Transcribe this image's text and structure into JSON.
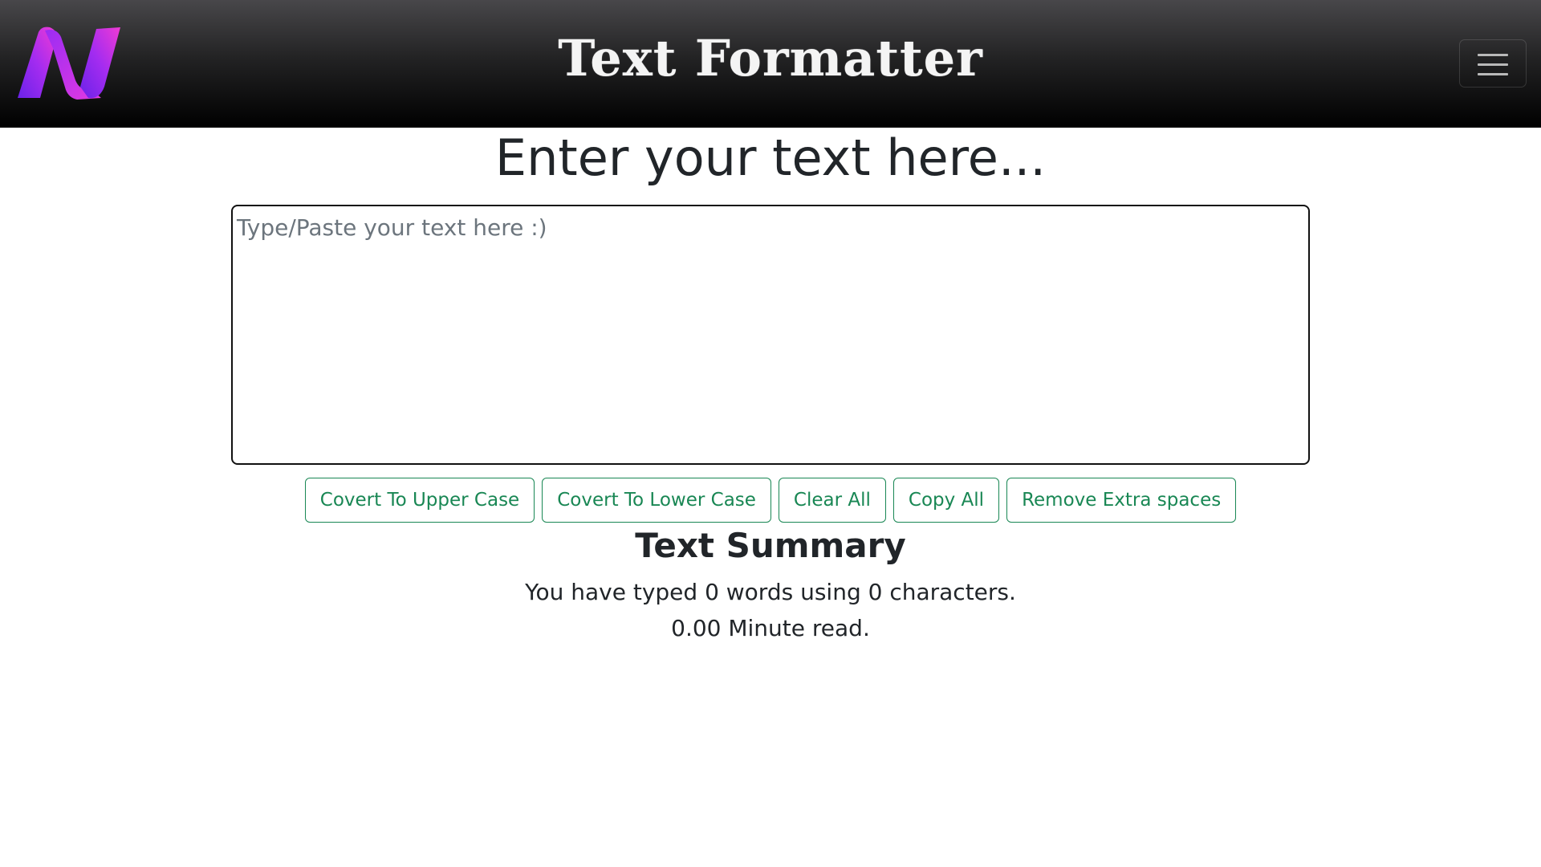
{
  "navbar": {
    "title": "Text Formatter",
    "logo_icon": "n-logo-icon",
    "menu_icon": "hamburger-menu-icon",
    "colors": {
      "logo_gradient_start": "#7b2ff7",
      "logo_gradient_end": "#f23ad6"
    }
  },
  "main": {
    "heading": "Enter your text here...",
    "textarea": {
      "placeholder": "Type/Paste your text here :)",
      "value": ""
    },
    "buttons": [
      {
        "label": "Covert To Upper Case"
      },
      {
        "label": "Covert To Lower Case"
      },
      {
        "label": "Clear All"
      },
      {
        "label": "Copy All"
      },
      {
        "label": "Remove Extra spaces"
      }
    ],
    "button_color": "#198754"
  },
  "summary": {
    "title": "Text Summary",
    "stats_text": "You have typed 0 words using 0 characters.",
    "read_time_text": "0.00 Minute read."
  }
}
